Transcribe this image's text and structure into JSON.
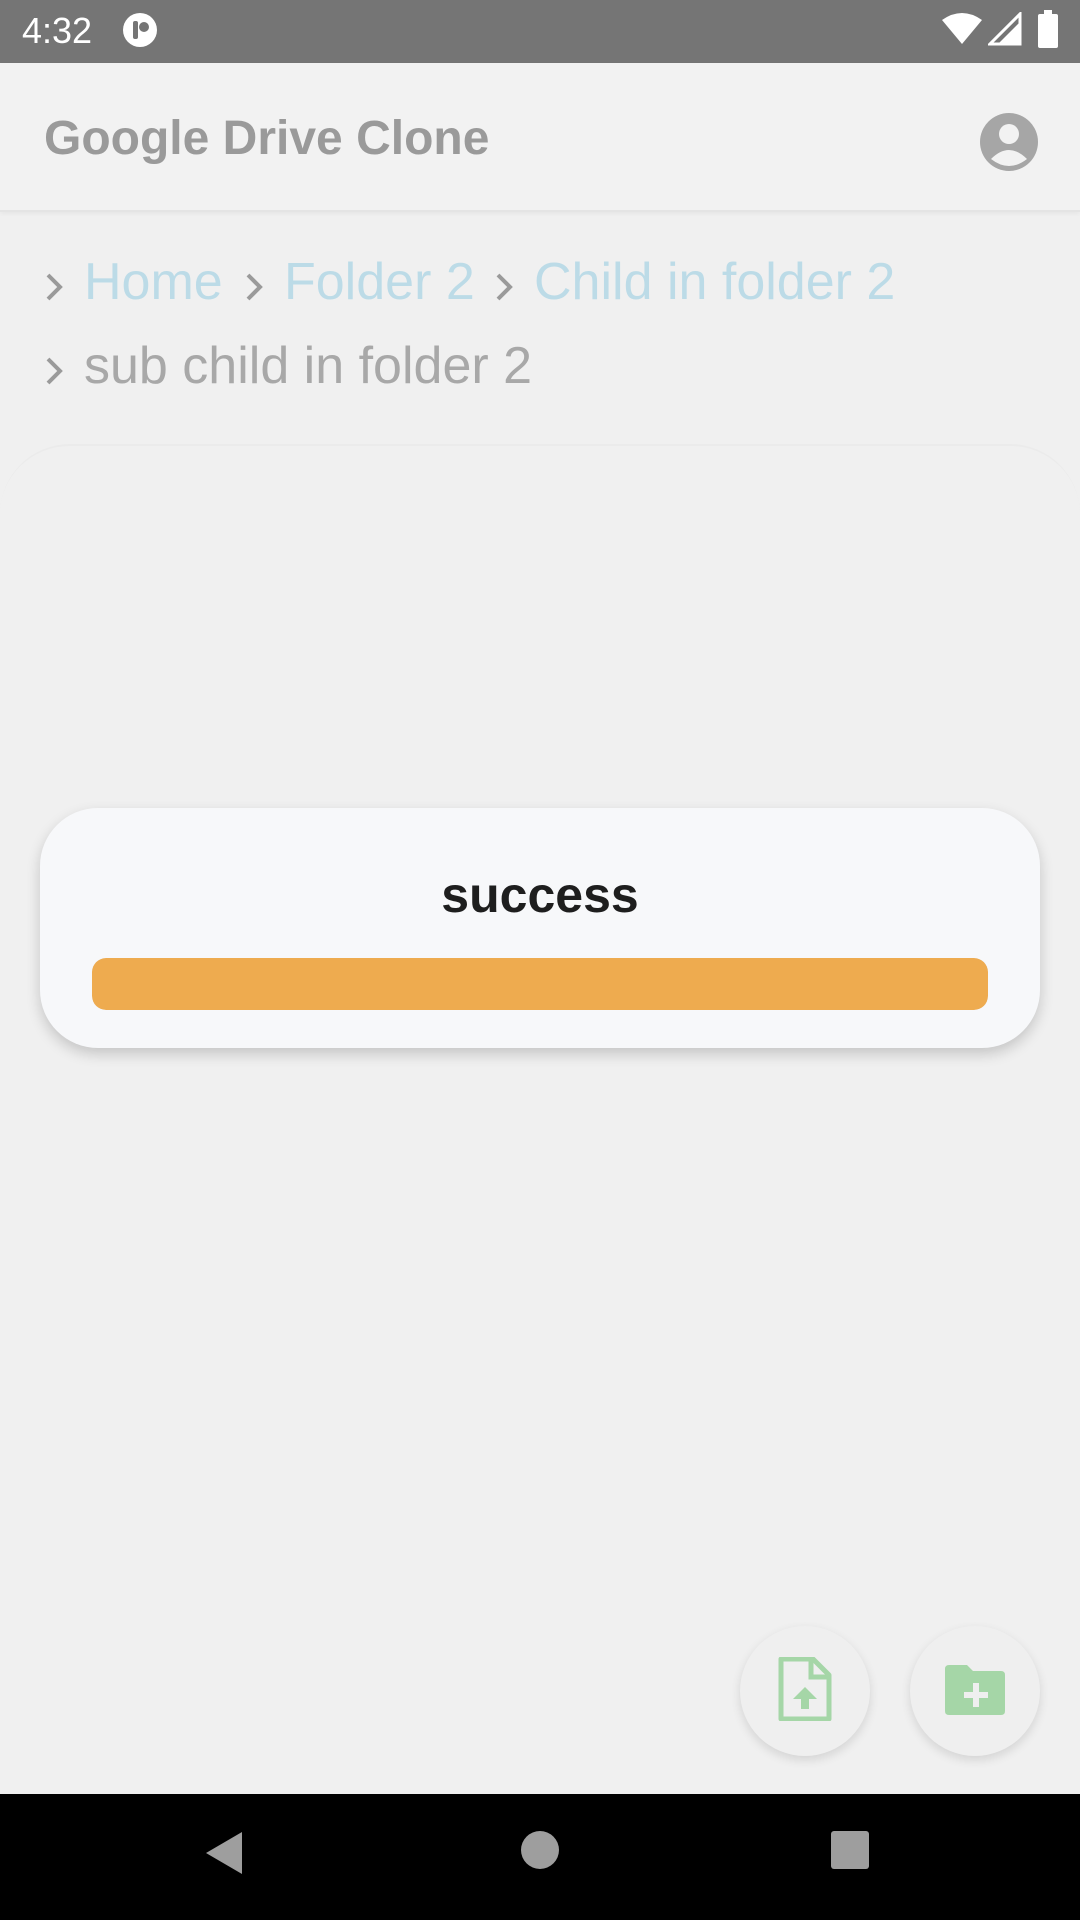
{
  "status_bar": {
    "time": "4:32",
    "icons": [
      "app-notification-icon",
      "wifi-icon",
      "cell-signal-icon",
      "battery-icon"
    ]
  },
  "app_bar": {
    "title": "Google Drive Clone",
    "account_icon": "account-circle-icon"
  },
  "breadcrumb": {
    "items": [
      {
        "label": "Home",
        "is_link": true
      },
      {
        "label": "Folder 2",
        "is_link": true
      },
      {
        "label": "Child in folder 2",
        "is_link": true
      },
      {
        "label": "sub child in folder 2",
        "is_link": false
      }
    ],
    "separator_icon": "chevron-right-icon"
  },
  "dialog": {
    "message": "success",
    "progress": 1.0,
    "progress_color": "#eeab4f"
  },
  "fabs": {
    "upload_icon": "upload-file-icon",
    "new_folder_icon": "create-new-folder-icon",
    "icon_color": "#a5d6a7"
  },
  "nav_bar": {
    "icons": [
      "back-icon",
      "home-icon",
      "recents-icon"
    ]
  },
  "colors": {
    "link": "#bcdbe7",
    "status_bar": "#757575",
    "accent": "#eeab4f"
  }
}
